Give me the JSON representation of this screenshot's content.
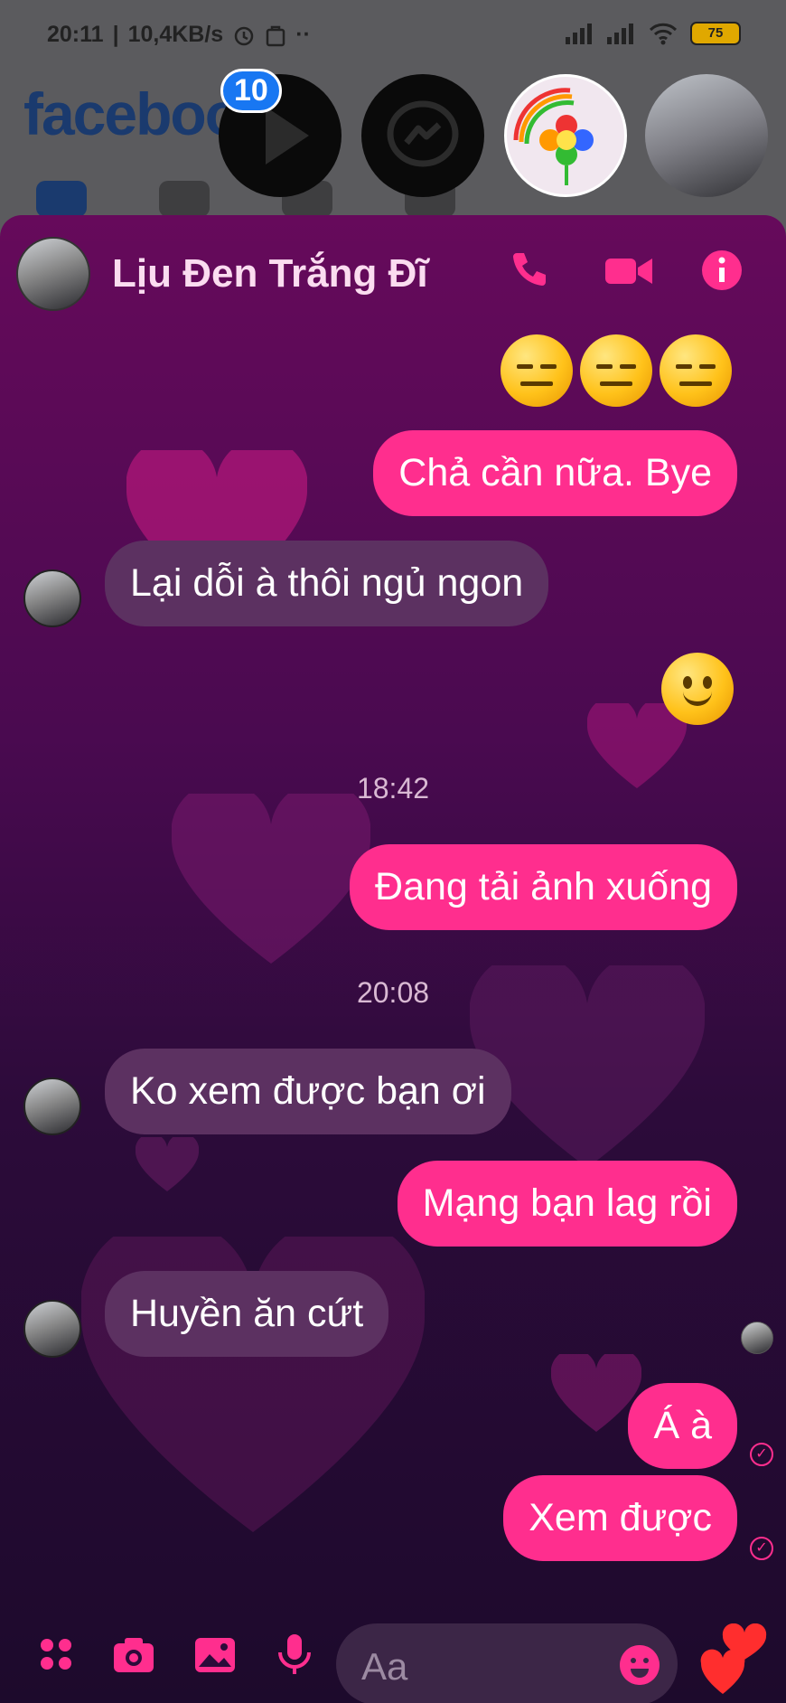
{
  "status": {
    "time": "20:11",
    "network_speed": "10,4KB/s",
    "battery": "75"
  },
  "background_app": {
    "logo": "facebook"
  },
  "chat_heads": {
    "badge": "10"
  },
  "chat": {
    "contact_name": "Lịu Đen Trắng Đĩ",
    "messages": [
      {
        "dir": "out",
        "text": "Chả cần nữa. Bye"
      },
      {
        "dir": "in",
        "text": "Lại dỗi à thôi ngủ ngon"
      },
      {
        "dir": "out",
        "text": "Đang tải ảnh xuống"
      },
      {
        "dir": "in",
        "text": "Ko xem được bạn ơi"
      },
      {
        "dir": "out",
        "text": "Mạng bạn lag rồi"
      },
      {
        "dir": "in",
        "text": "Huyền ăn cứt"
      },
      {
        "dir": "out",
        "text": "Á à"
      },
      {
        "dir": "out",
        "text": "Xem được"
      }
    ],
    "timestamps": [
      "18:42",
      "20:08"
    ],
    "composer_placeholder": "Aa"
  },
  "colors": {
    "accent": "#ff2e8e",
    "incoming_bubble": "#5c3161",
    "header_text": "#fbdcf0"
  }
}
